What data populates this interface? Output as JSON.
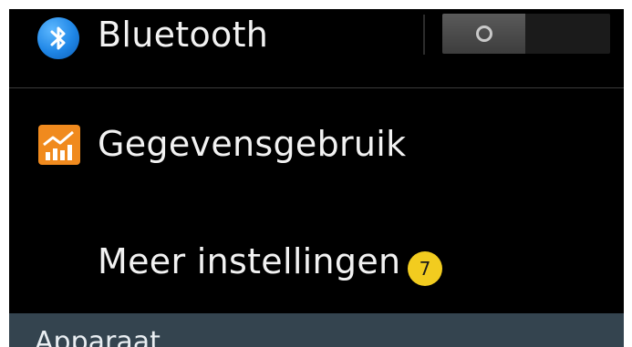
{
  "settings": {
    "bluetooth": {
      "label": "Bluetooth",
      "icon": "bluetooth-icon",
      "toggle_state": "off",
      "toggle_glyph": "O"
    },
    "data_usage": {
      "label": "Gegevensgebruik",
      "icon": "data-usage-chart-icon"
    },
    "more_settings": {
      "label": "Meer instellingen",
      "badge": "7"
    }
  },
  "section": {
    "device_header": "Apparaat"
  },
  "colors": {
    "background": "#000000",
    "text": "#f2f2f2",
    "bluetooth_blue": "#1f86e6",
    "data_orange": "#f08a1e",
    "badge_yellow": "#f2cc1f",
    "section_header_bg": "#34444f"
  }
}
